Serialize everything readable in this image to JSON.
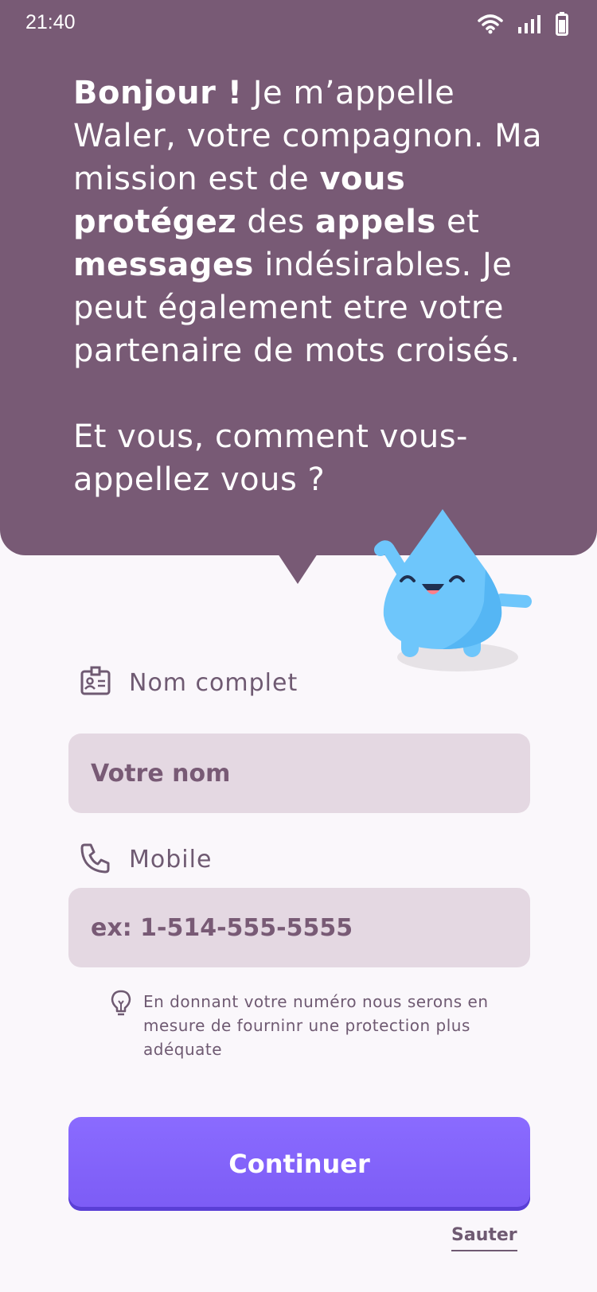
{
  "status_bar": {
    "time": "21:40",
    "icons": [
      "wifi-icon",
      "signal-icon",
      "battery-icon"
    ]
  },
  "intro": {
    "p1_bold1": "Bonjour !",
    "p1_t1": " Je m’appelle Waler, votre compagnon. Ma mission est de ",
    "p1_bold2": "vous protégez",
    "p1_t2": " des ",
    "p1_bold3": "appels",
    "p1_t3": " et ",
    "p1_bold4": "messages",
    "p1_t4": " indésirables. Je peut également etre votre partenaire de mots croisés.",
    "p2": "Et vous, comment vous-appellez vous ?"
  },
  "mascot": {
    "name": "water-drop-mascot"
  },
  "form": {
    "name_label": "Nom complet",
    "name_placeholder": "Votre nom",
    "name_value": "",
    "mobile_label": "Mobile",
    "mobile_placeholder": "ex: 1-514-555-5555",
    "mobile_value": "",
    "hint": "En donnant votre numéro nous serons en mesure de fourninr une protection plus adéquate"
  },
  "actions": {
    "continue_label": "Continuer",
    "skip_label": "Sauter"
  },
  "colors": {
    "header_bg": "#785a75",
    "page_bg": "#faf7fb",
    "input_bg": "#e4d8e2",
    "accent": "#7c5cf5",
    "text_muted": "#6f5a72",
    "mascot": "#6ec6fb"
  }
}
